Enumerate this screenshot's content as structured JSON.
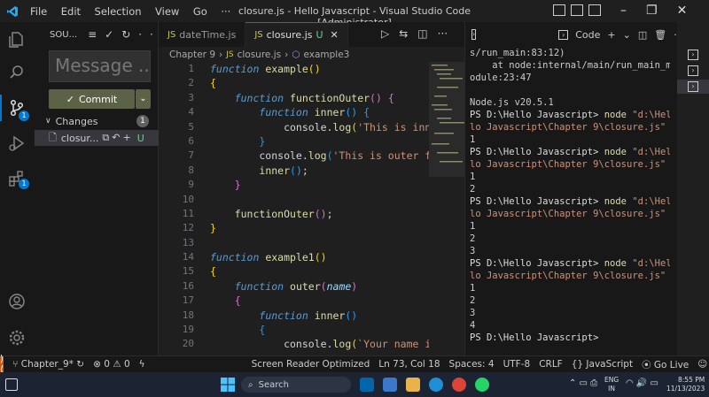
{
  "titlebar": {
    "menus": [
      "File",
      "Edit",
      "Selection",
      "View",
      "Go",
      "···"
    ],
    "title": "closure.js - Hello Javascript - Visual Studio Code [Administrator]"
  },
  "sidebar": {
    "header": "SOU...",
    "message_placeholder": "Message ...",
    "commit_label": "Commit",
    "changes_label": "Changes",
    "changes_count": "1",
    "file_name": "closur...",
    "file_status": "U"
  },
  "badges": {
    "scm": "1",
    "extensions": "1"
  },
  "tabs": [
    {
      "label": "dateTime.js",
      "status": ""
    },
    {
      "label": "closure.js",
      "status": "U"
    }
  ],
  "breadcrumb": {
    "folder": "Chapter 9",
    "file": "closure.js",
    "symbol": "example3"
  },
  "editor": {
    "line_numbers": [
      "1",
      "2",
      "3",
      "4",
      "5",
      "6",
      "7",
      "8",
      "9",
      "10",
      "11",
      "12",
      "13",
      "14",
      "15",
      "16",
      "17",
      "18",
      "19",
      "20"
    ]
  },
  "panel": {
    "terminal_name": "Code"
  },
  "terminal": {
    "lines": [
      "s/run_main:83:12)",
      "    at node:internal/main/run_main_m",
      "odule:23:47",
      "",
      "Node.js v20.5.1",
      "PS D:\\Hello Javascript> node \"d:\\Hel",
      "lo Javascript\\Chapter 9\\closure.js\"",
      "1",
      "PS D:\\Hello Javascript> node \"d:\\Hel",
      "lo Javascript\\Chapter 9\\closure.js\"",
      "1",
      "2",
      "PS D:\\Hello Javascript> node \"d:\\Hel",
      "lo Javascript\\Chapter 9\\closure.js\"",
      "1",
      "2",
      "3",
      "PS D:\\Hello Javascript> node \"d:\\Hel",
      "lo Javascript\\Chapter 9\\closure.js\"",
      "1",
      "2",
      "3",
      "4",
      "PS D:\\Hello Javascript> "
    ]
  },
  "statusbar": {
    "branch": "Chapter_9*",
    "errors": "0",
    "warnings": "0",
    "screen_reader": "Screen Reader Optimized",
    "position": "Ln 73, Col 18",
    "spaces": "Spaces: 4",
    "encoding": "UTF-8",
    "eol": "CRLF",
    "language": "JavaScript",
    "golive": "Go Live"
  },
  "taskbar": {
    "search": "Search",
    "lang": "ENG",
    "region": "IN",
    "time": "8:55 PM",
    "date": "11/13/2023"
  },
  "colors": {
    "accent": "#0078d4",
    "commit": "#5b6246",
    "remote": "#c75a12"
  }
}
